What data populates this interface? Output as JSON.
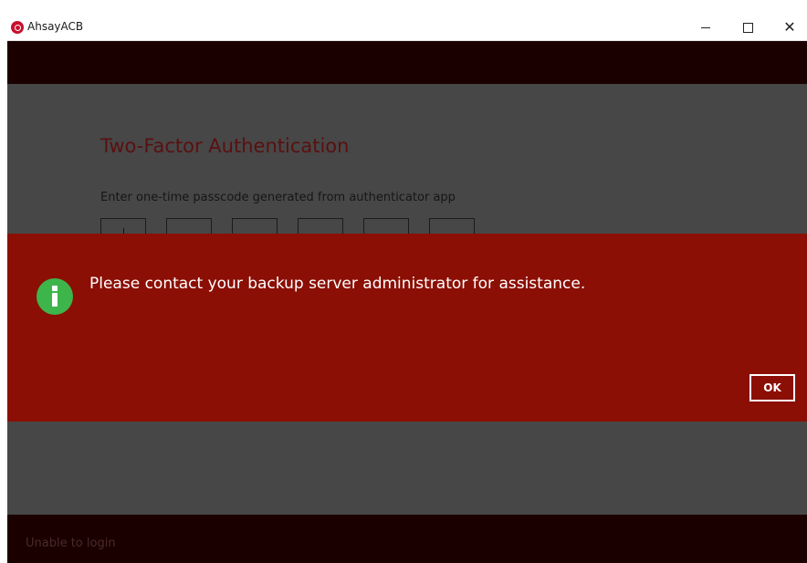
{
  "window": {
    "title": "AhsayACB",
    "logo_icon": "ahsay-logo-icon",
    "controls": {
      "minimize_icon": "minimize-icon",
      "maximize_icon": "maximize-icon",
      "close_icon": "close-icon",
      "close_glyph": "✕"
    }
  },
  "background_form": {
    "title": "Two-Factor Authentication",
    "instruction": "Enter one-time passcode generated from authenticator app",
    "code_boxes": [
      "",
      "",
      "",
      "",
      "",
      ""
    ]
  },
  "dialog": {
    "icon": "info-icon",
    "message": "Please contact your backup server administrator for assistance.",
    "ok_label": "OK"
  },
  "status_bar": {
    "text": "Unable to login"
  },
  "colors": {
    "dialog_bg": "#8b0f05",
    "info_icon": "#3db54a",
    "band_dark": "#1b0000",
    "dim_overlay": "#474747"
  }
}
